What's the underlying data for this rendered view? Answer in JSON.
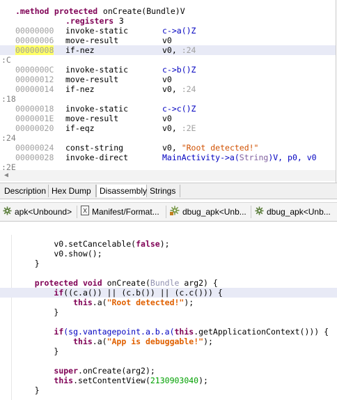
{
  "smali": {
    "header_lines": [
      {
        "directive": ".method",
        "rest_keyword": "protected",
        "rest": " onCreate(Bundle)V"
      },
      {
        "directive": ".registers",
        "rest": " 3"
      }
    ],
    "instructions": [
      {
        "type": "ins",
        "addr": "00000000",
        "op": "invoke-static",
        "args": [
          {
            "t": "c->a()Z",
            "c": "blue"
          }
        ]
      },
      {
        "type": "ins",
        "addr": "00000006",
        "op": "move-result",
        "args": [
          {
            "t": "v0",
            "c": "plain"
          }
        ]
      },
      {
        "type": "ins",
        "addr": "00000008",
        "op": "if-nez",
        "args": [
          {
            "t": "v0, ",
            "c": "plain"
          },
          {
            "t": ":24",
            "c": "gray"
          }
        ],
        "selected": true
      },
      {
        "type": "label",
        "text": ":C"
      },
      {
        "type": "ins",
        "addr": "0000000C",
        "op": "invoke-static",
        "args": [
          {
            "t": "c->b()Z",
            "c": "blue"
          }
        ]
      },
      {
        "type": "ins",
        "addr": "00000012",
        "op": "move-result",
        "args": [
          {
            "t": "v0",
            "c": "plain"
          }
        ]
      },
      {
        "type": "ins",
        "addr": "00000014",
        "op": "if-nez",
        "args": [
          {
            "t": "v0, ",
            "c": "plain"
          },
          {
            "t": ":24",
            "c": "gray"
          }
        ]
      },
      {
        "type": "label",
        "text": ":18"
      },
      {
        "type": "ins",
        "addr": "00000018",
        "op": "invoke-static",
        "args": [
          {
            "t": "c->c()Z",
            "c": "blue"
          }
        ]
      },
      {
        "type": "ins",
        "addr": "0000001E",
        "op": "move-result",
        "args": [
          {
            "t": "v0",
            "c": "plain"
          }
        ]
      },
      {
        "type": "ins",
        "addr": "00000020",
        "op": "if-eqz",
        "args": [
          {
            "t": "v0, ",
            "c": "plain"
          },
          {
            "t": ":2E",
            "c": "gray"
          }
        ]
      },
      {
        "type": "label",
        "text": ":24"
      },
      {
        "type": "ins",
        "addr": "00000024",
        "op": "const-string",
        "args": [
          {
            "t": "v0, ",
            "c": "plain"
          },
          {
            "t": "\"Root detected!\"",
            "c": "red"
          }
        ]
      },
      {
        "type": "ins",
        "addr": "00000028",
        "op": "invoke-direct",
        "args": [
          {
            "t": "MainActivity->a(",
            "c": "blue"
          },
          {
            "t": "String",
            "c": "purple"
          },
          {
            "t": ")V, p0, v0",
            "c": "blue"
          }
        ]
      },
      {
        "type": "label",
        "text": ":2E"
      }
    ],
    "scroll_arrow": "◀"
  },
  "view_tabs": [
    {
      "label": "Description",
      "active": false
    },
    {
      "label": "Hex Dump",
      "active": false
    },
    {
      "label": "Disassembly",
      "active": true
    },
    {
      "label": "Strings",
      "active": false
    }
  ],
  "editor_tabs": [
    {
      "label": "apk<Unbound>",
      "icon": "android-gear-icon"
    },
    {
      "label": "Manifest/Format...",
      "icon": "xml-file-icon"
    },
    {
      "label": "dbug_apk<Unb...",
      "icon": "android-gear-icon"
    },
    {
      "label": "dbug_apk<Unb...",
      "icon": "android-gear-icon"
    }
  ],
  "java": {
    "lines": [
      [
        {
          "t": "        v0.setCancelable(",
          "c": ""
        },
        {
          "t": "false",
          "c": "k"
        },
        {
          "t": ");",
          "c": ""
        }
      ],
      [
        {
          "t": "        v0.show();",
          "c": ""
        }
      ],
      [
        {
          "t": "    }",
          "c": ""
        }
      ],
      [
        {
          "t": "",
          "c": ""
        }
      ],
      [
        {
          "t": "    ",
          "c": ""
        },
        {
          "t": "protected void",
          "c": "k"
        },
        {
          "t": " onCreate(",
          "c": ""
        },
        {
          "t": "Bundle",
          "c": "t"
        },
        {
          "t": " arg2) {",
          "c": ""
        }
      ],
      [
        {
          "t": "        ",
          "c": ""
        },
        {
          "t": "if",
          "c": "k"
        },
        {
          "t": "((c.a()) || (c.b()) || (c.c())) {",
          "c": ""
        }
      ],
      [
        {
          "t": "            ",
          "c": ""
        },
        {
          "t": "this",
          "c": "k"
        },
        {
          "t": ".a(",
          "c": ""
        },
        {
          "t": "\"Root detected!\"",
          "c": "s"
        },
        {
          "t": ");",
          "c": ""
        }
      ],
      [
        {
          "t": "        }",
          "c": ""
        }
      ],
      [
        {
          "t": "",
          "c": ""
        }
      ],
      [
        {
          "t": "        ",
          "c": ""
        },
        {
          "t": "if",
          "c": "k"
        },
        {
          "t": "(sg.vantagepoint.a.b.a(",
          "c": "f"
        },
        {
          "t": "this",
          "c": "k"
        },
        {
          "t": ".getApplicationContext())) {",
          "c": ""
        }
      ],
      [
        {
          "t": "            ",
          "c": ""
        },
        {
          "t": "this",
          "c": "k"
        },
        {
          "t": ".a(",
          "c": ""
        },
        {
          "t": "\"App is debuggable!\"",
          "c": "s"
        },
        {
          "t": ");",
          "c": ""
        }
      ],
      [
        {
          "t": "        }",
          "c": ""
        }
      ],
      [
        {
          "t": "",
          "c": ""
        }
      ],
      [
        {
          "t": "        ",
          "c": ""
        },
        {
          "t": "super",
          "c": "k"
        },
        {
          "t": ".onCreate(arg2);",
          "c": ""
        }
      ],
      [
        {
          "t": "        ",
          "c": ""
        },
        {
          "t": "this",
          "c": "k"
        },
        {
          "t": ".setContentView(",
          "c": ""
        },
        {
          "t": "2130903040",
          "c": "n"
        },
        {
          "t": ");",
          "c": ""
        }
      ],
      [
        {
          "t": "    }",
          "c": ""
        }
      ]
    ],
    "highlighted_line": 5
  }
}
